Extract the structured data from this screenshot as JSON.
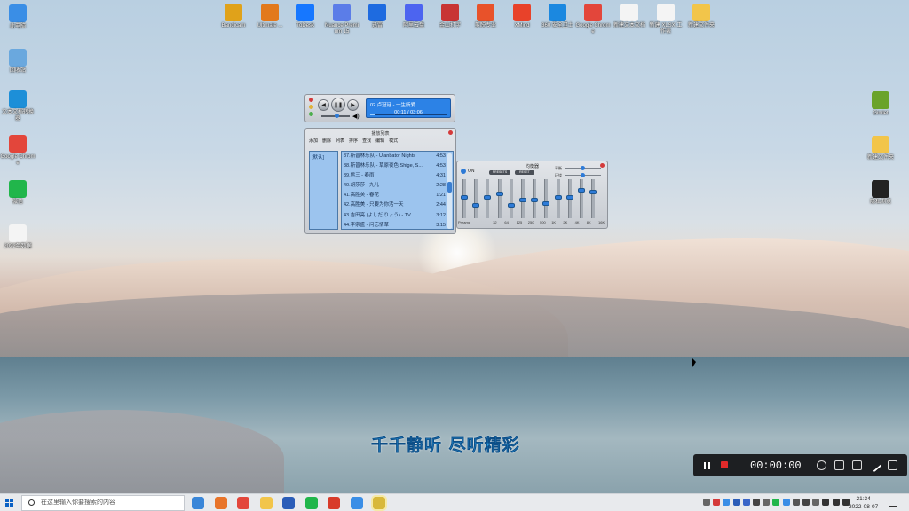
{
  "desktop_left": [
    {
      "label": "此电脑",
      "icon": "computer-icon",
      "color": "#3a8ee6"
    },
    {
      "label": "回收站",
      "icon": "recycle-bin-icon",
      "color": "#6aa8de"
    },
    {
      "label": "文本文档转换器",
      "icon": "app-hex-icon",
      "color": "#1d8fd8"
    },
    {
      "label": "Google Chrome",
      "icon": "chrome-icon",
      "color": "#e3463b"
    },
    {
      "label": "微信",
      "icon": "wechat-icon",
      "color": "#21b64b"
    },
    {
      "label": "2022年数据",
      "icon": "document-icon",
      "color": "#f4f4f4"
    }
  ],
  "desktop_top": [
    {
      "label": "Bandicam",
      "icon": "app-puzzle-icon",
      "color": "#e0a21a"
    },
    {
      "label": "Ultimate ...",
      "icon": "app-orange-icon",
      "color": "#e2791c"
    },
    {
      "label": "ToDesk",
      "icon": "todesk-icon",
      "color": "#1677ff"
    },
    {
      "label": "Nuance Premium 15",
      "icon": "app-ring-icon",
      "color": "#5b7de8"
    },
    {
      "label": "迅雷",
      "icon": "thunder-icon",
      "color": "#1e6be0"
    },
    {
      "label": "阿里云盘",
      "icon": "cloud-icon",
      "color": "#4c64f0"
    },
    {
      "label": "金山打字",
      "icon": "app-diamond-icon",
      "color": "#c83434"
    },
    {
      "label": "剪映专业",
      "icon": "app-edit-icon",
      "color": "#e8522a"
    },
    {
      "label": "XMind",
      "icon": "xmind-icon",
      "color": "#e8422a"
    },
    {
      "label": "360 安全卫士",
      "icon": "shield-icon",
      "color": "#1b88e0"
    },
    {
      "label": "Google Chrome",
      "icon": "chrome-icon",
      "color": "#e3463b"
    },
    {
      "label": "新建文本文档",
      "icon": "document-icon",
      "color": "#f4f4f4"
    },
    {
      "label": "新建 XLSX 工作表",
      "icon": "excel-icon",
      "color": "#f4f4f4"
    },
    {
      "label": "新建文件夹",
      "icon": "folder-icon",
      "color": "#f2c54a"
    }
  ],
  "desktop_right": [
    {
      "label": "Gimlet",
      "icon": "lambda-icon",
      "color": "#6aa32a"
    },
    {
      "label": "新建文件夹",
      "icon": "folder-icon",
      "color": "#f2c54a"
    },
    {
      "label": "隐私浏览",
      "icon": "incognito-icon",
      "color": "#222222"
    }
  ],
  "player": {
    "track": "02.卢冠廷 - 一生所爱",
    "time": "00:11 / 03:06",
    "progress": 0.06,
    "volume": 0.55
  },
  "playlist": {
    "title": "播放列表",
    "menu": [
      "添加",
      "删除",
      "列表",
      "排序",
      "查找",
      "编辑",
      "模式"
    ],
    "group": "[默认]",
    "rows": [
      {
        "name": "37.斯普林乐队 - Ulanbator Nights",
        "time": "4:53"
      },
      {
        "name": "38.斯普林乐队 - 草原夜色 Shige, S...",
        "time": "4:53"
      },
      {
        "name": "39.熊三 - 春雨",
        "time": "4:31"
      },
      {
        "name": "40.胡莎莎 - 九儿",
        "time": "2:28"
      },
      {
        "name": "41.高胜美 - 春花",
        "time": "1:21"
      },
      {
        "name": "42.高胜美 - 只要为你活一天",
        "time": "2:44"
      },
      {
        "name": "43.吉田亮 (よしだ りょう) - TV...",
        "time": "3:12"
      },
      {
        "name": "44.李宗盛 - 问忘情草",
        "time": "3:15"
      }
    ]
  },
  "equalizer": {
    "title": "均衡器",
    "on": "ON",
    "presets": "PRESETS",
    "reset": "RESET",
    "balance": "平衡",
    "surround": "环绕",
    "bands": [
      {
        "label": "Preamp",
        "level": 0.55
      },
      {
        "label": "32",
        "level": 0.3
      },
      {
        "label": "64",
        "level": 0.55
      },
      {
        "label": "125",
        "level": 0.65
      },
      {
        "label": "250",
        "level": 0.3
      },
      {
        "label": "500",
        "level": 0.45
      },
      {
        "label": "1K",
        "level": 0.45
      },
      {
        "label": "2K",
        "level": 0.35
      },
      {
        "label": "4K",
        "level": 0.55
      },
      {
        "label": "8K",
        "level": 0.55
      },
      {
        "label": "16K",
        "level": 0.75
      },
      {
        "label": "16K+",
        "level": 0.7
      }
    ]
  },
  "lyric": "千千静听 尽听精彩",
  "recorder": {
    "time": "00:00:00"
  },
  "taskbar": {
    "search_placeholder": "在这里输入你要搜索的内容",
    "apps": [
      "search-icon",
      "browser-icon",
      "chrome-icon",
      "folder-icon",
      "word-icon",
      "wechat-icon",
      "wps-icon",
      "ttplayer-icon",
      "app-active-icon"
    ],
    "time": "21:34",
    "date": "2022-08-07"
  }
}
